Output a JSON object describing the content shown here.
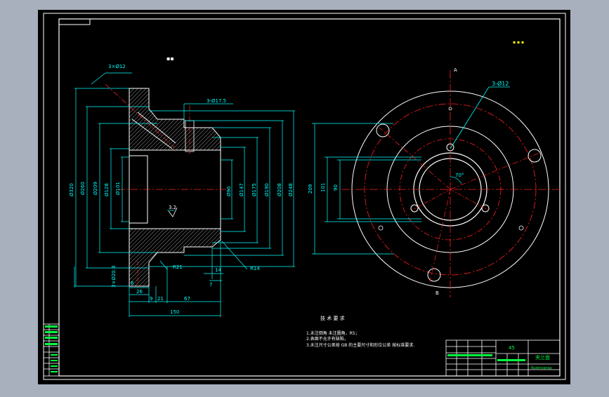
{
  "drawing": {
    "title_block": {
      "part_name": "夹兰盘",
      "material": "45",
      "school_line": "Ruienyanga"
    },
    "technical_requirements": {
      "heading": "技 术 要 求",
      "items": [
        "1.未注倒角 未注圆角，R5；",
        "2.表面不允许有缺陷，",
        "3.未注尺寸公差按 GB 的主要尺寸和形位公差 按标准要求."
      ]
    },
    "side_view": {
      "hole_callout_1": "3×Ø12",
      "hole_callout_2": "3-Ø17.5",
      "diameters": [
        "Ø320",
        "Ø260",
        "Ø209",
        "Ø128",
        "Ø101",
        "Ø90",
        "Ø147",
        "Ø175",
        "Ø190",
        "Ø208",
        "Ø248"
      ],
      "roughness": "3.2",
      "radius_1": "R21",
      "radius_2": "R14",
      "lengths": [
        "6",
        "26",
        "9",
        "21",
        "67",
        "150",
        "14",
        "7"
      ],
      "bottom_callout": "3×Ø20.8"
    },
    "front_view": {
      "hole_callout": "3-Ø12",
      "angle": "70°",
      "vertical_dims": [
        "209",
        "101",
        "90"
      ],
      "axis_top_label": "A",
      "axis_bottom_label": "B"
    },
    "misc": {
      "top_mark": "▪▪",
      "roughness_note": "▪ ▪ ▪"
    }
  }
}
